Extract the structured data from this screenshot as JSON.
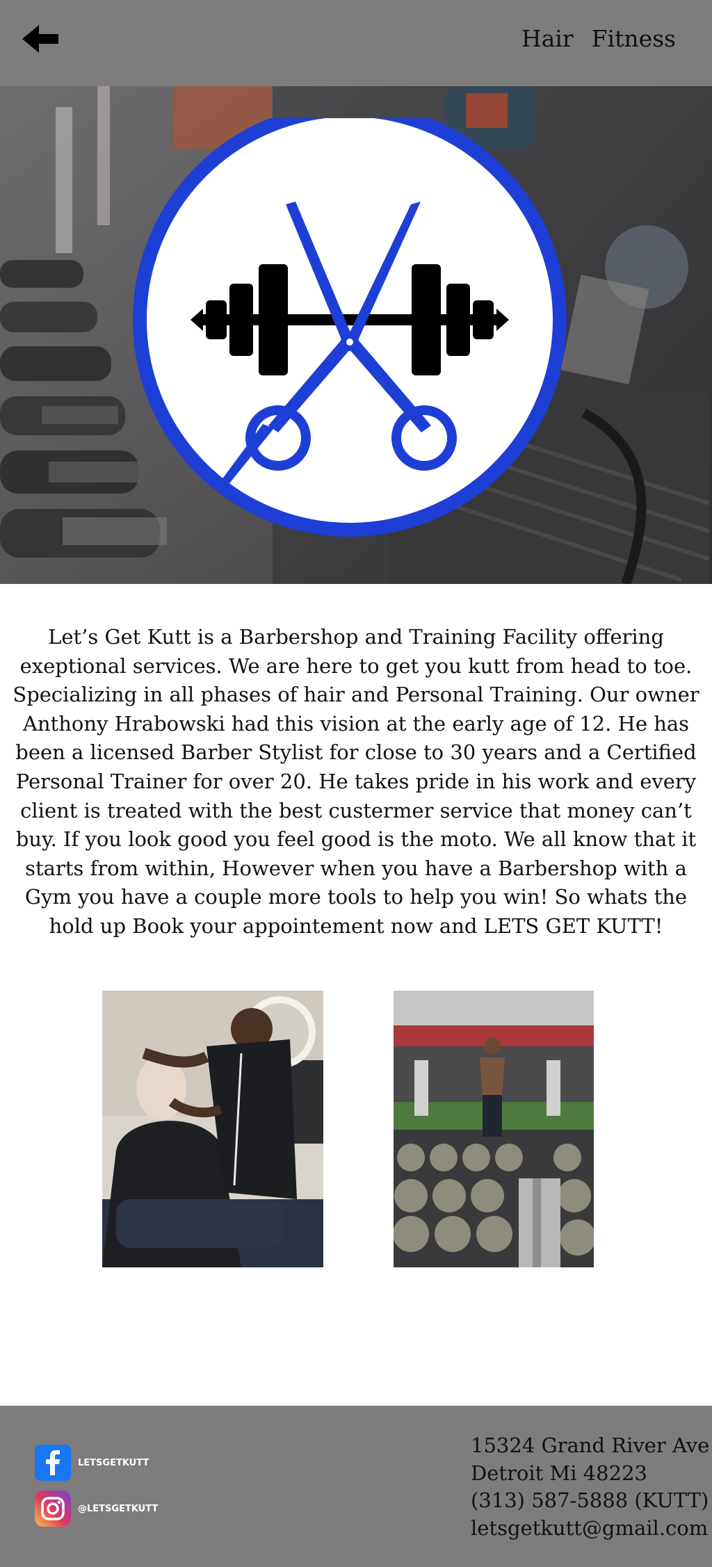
{
  "nav": {
    "back_icon": "back-arrow-icon",
    "items": [
      {
        "label": "Hair"
      },
      {
        "label": "Fitness"
      }
    ]
  },
  "hero": {
    "logo_icon": "scissors-dumbbell-logo",
    "logo_color": "#1d3fd6"
  },
  "about": {
    "text": "Let’s Get Kutt is a Barbershop and Training Facility offering exeptional services. We are here to get you kutt from head to toe. Specializing in all phases of hair and Personal Training. Our owner Anthony Hrabowski had this vision at the early age of 12. He has been a licensed Barber Stylist for close to 30 years and a Certified Personal Trainer for over 20. He takes pride in his work and every client is treated with the best custermer service that money can’t buy. If you look good you feel good is the moto. We all know that it starts from within, However when you have a Barbershop with a Gym you have a couple more tools to help you win! So whats the hold up Book your appointement now and LETS GET KUTT!"
  },
  "footer": {
    "facebook": {
      "icon": "facebook-icon",
      "handle": "LETSGETKUTT",
      "color": "#1877f2"
    },
    "instagram": {
      "icon": "instagram-icon",
      "handle": "@LETSGETKUTT"
    },
    "address_line1": "15324 Grand River Ave",
    "address_line2": "Detroit Mi 48223",
    "phone": "(313) 587-5888 (KUTT)",
    "email": "letsgetkutt@gmail.com"
  }
}
